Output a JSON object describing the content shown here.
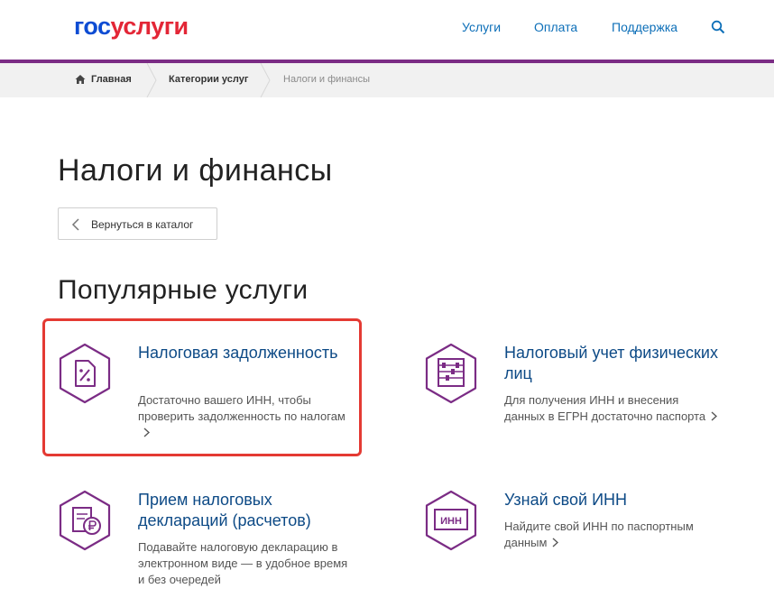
{
  "header": {
    "logo_part1": "гос",
    "logo_part2": "услуги",
    "nav": [
      "Услуги",
      "Оплата",
      "Поддержка"
    ],
    "search_icon": "search-icon"
  },
  "breadcrumb": [
    "Главная",
    "Категории услуг",
    "Налоги и финансы"
  ],
  "page_title": "Налоги и финансы",
  "back_button": "Вернуться в каталог",
  "section_title": "Популярные услуги",
  "cards": [
    {
      "title": "Налоговая задолженность",
      "desc": "Достаточно вашего ИНН, чтобы проверить задолженность по налогам",
      "icon": "tax-percent-icon"
    },
    {
      "title": "Налоговый учет физических лиц",
      "desc": "Для получения ИНН и внесения данных в ЕГРН достаточно паспорта",
      "icon": "abacus-icon"
    },
    {
      "title": "Прием налоговых деклараций (расчетов)",
      "desc": "Подавайте налоговую декларацию в электронном виде — в удобное время и без очередей",
      "icon": "ruble-document-icon"
    },
    {
      "title": "Узнай свой ИНН",
      "desc": "Найдите свой ИНН по паспортным данным",
      "icon": "inn-icon",
      "icon_text": "ИНН"
    }
  ],
  "colors": {
    "brand_blue": "#0d4cd3",
    "brand_red": "#e32636",
    "purple": "#7b2c85",
    "highlight": "#e43a33"
  }
}
